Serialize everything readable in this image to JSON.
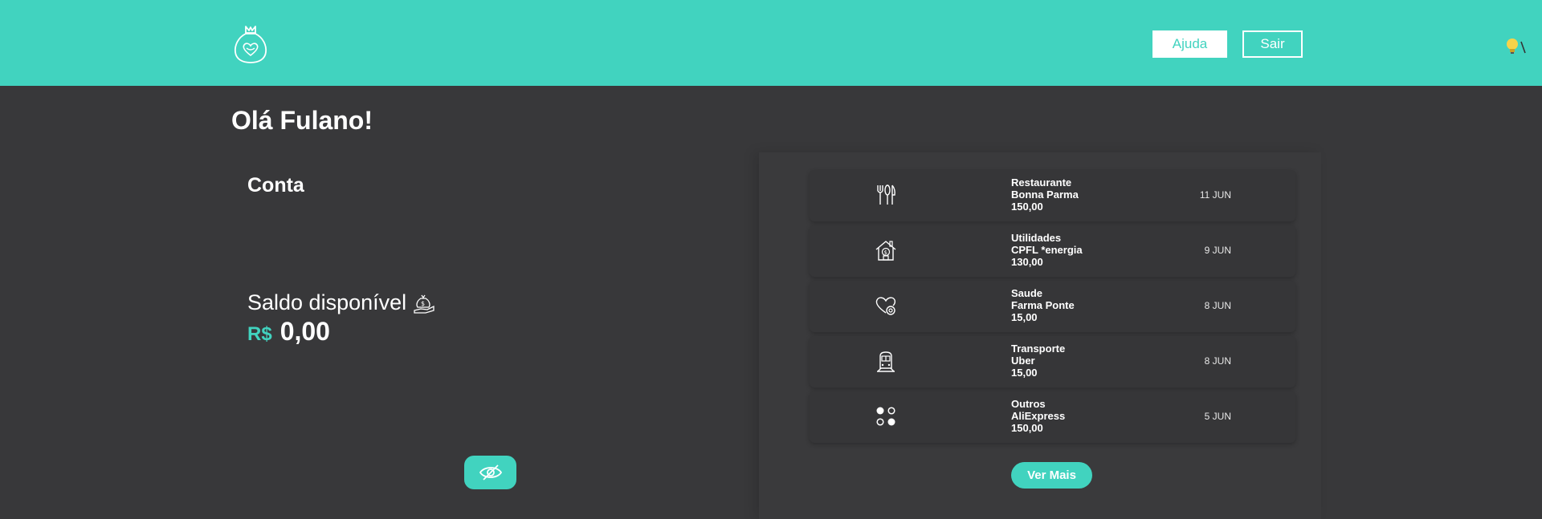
{
  "header": {
    "ajuda_label": "Ajuda",
    "sair_label": "Sair",
    "accent_color": "#41d3bf",
    "logo_icon": "money-bag-heart-icon",
    "theme_icon": "lightbulb-icon"
  },
  "greeting": "Olá Fulano!",
  "account": {
    "title": "Conta",
    "balance_label": "Saldo disponível",
    "balance_icon": "money-bag-hand-icon",
    "currency": "R$",
    "balance_value": "0,00",
    "toggle_icon": "eye-hidden-icon"
  },
  "transactions": [
    {
      "category": "Restaurante",
      "merchant": "Bonna Parma",
      "amount": "150,00",
      "date": "11 JUN",
      "icon": "fork-knife-icon"
    },
    {
      "category": "Utilidades",
      "merchant": "CPFL *energia",
      "amount": "130,00",
      "date": "9 JUN",
      "icon": "house-dollar-icon"
    },
    {
      "category": "Saude",
      "merchant": "Farma Ponte",
      "amount": "15,00",
      "date": "8 JUN",
      "icon": "heart-health-icon"
    },
    {
      "category": "Transporte",
      "merchant": "Uber",
      "amount": "15,00",
      "date": "8 JUN",
      "icon": "train-icon"
    },
    {
      "category": "Outros",
      "merchant": "AliExpress",
      "amount": "150,00",
      "date": "5 JUN",
      "icon": "dots-grid-icon"
    }
  ],
  "ver_mais_label": "Ver Mais"
}
